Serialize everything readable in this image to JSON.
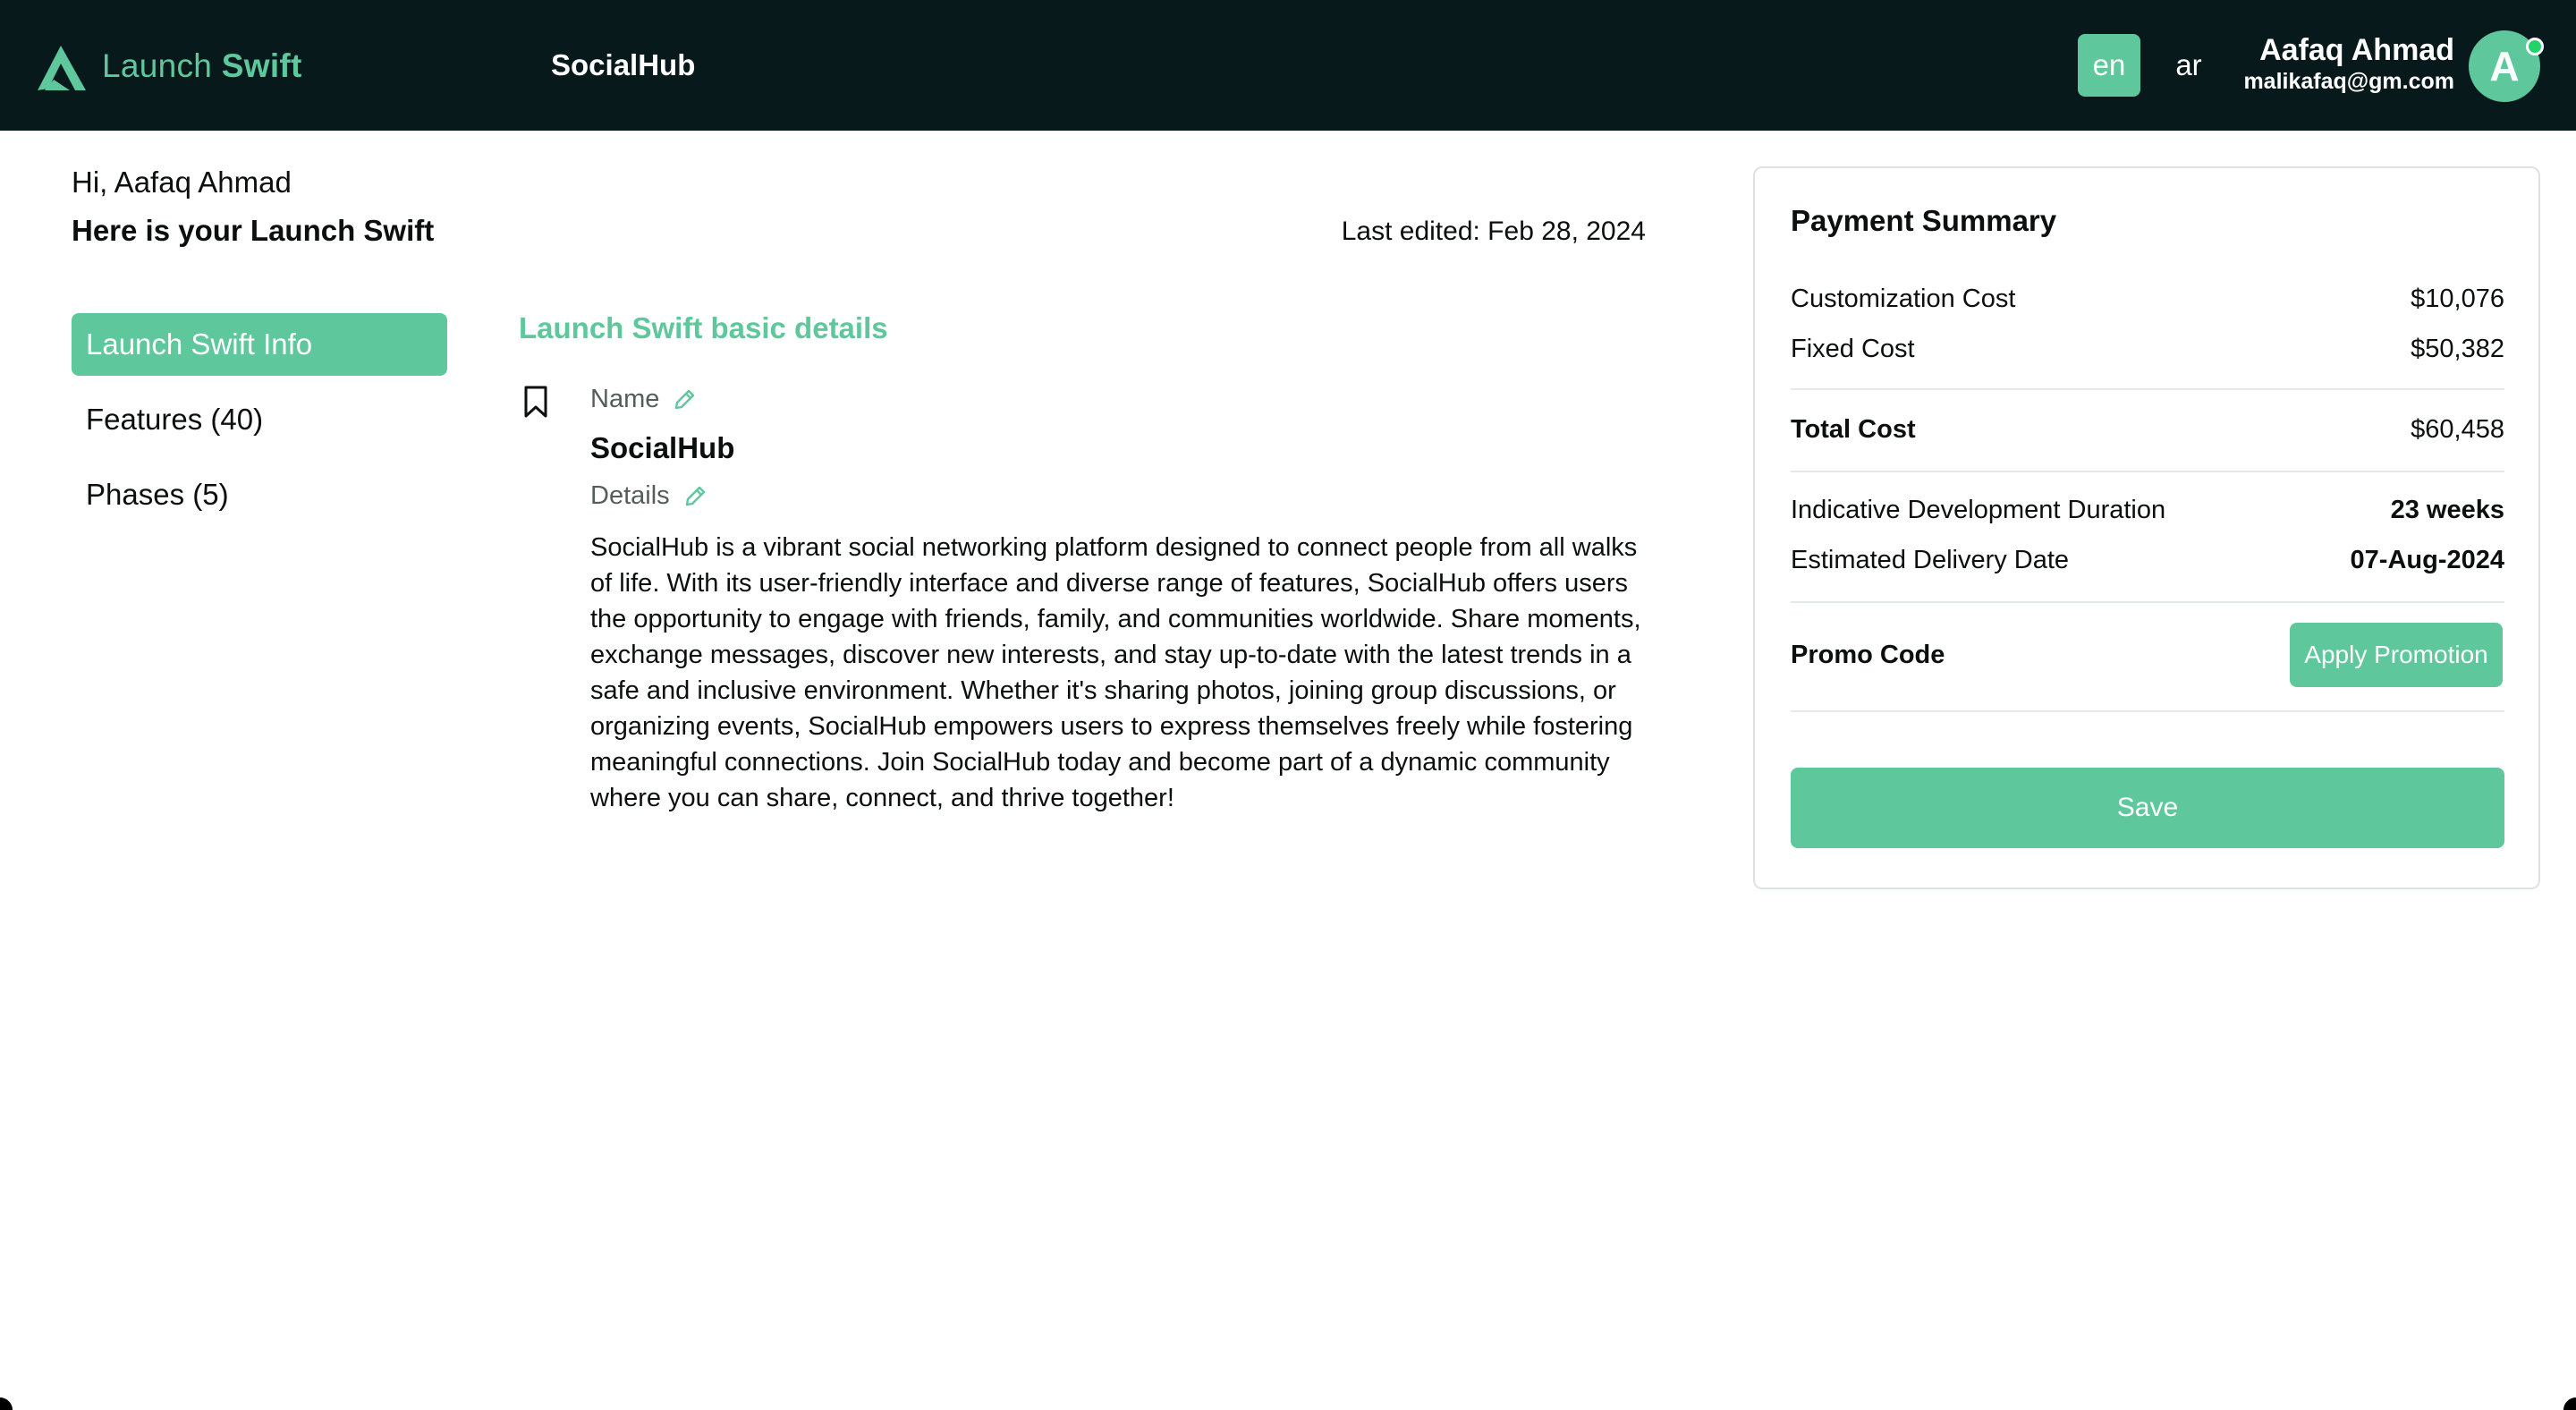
{
  "header": {
    "logo_text_light": "Launch",
    "logo_text_bold": "Swift",
    "app_name": "SocialHub",
    "languages": [
      "en",
      "ar"
    ],
    "active_language": "en",
    "user": {
      "name": "Aafaq Ahmad",
      "email": "malikafaq@gm.com",
      "avatar_initial": "A",
      "online": true
    }
  },
  "greeting": {
    "hello": "Hi, Aafaq Ahmad",
    "subtitle": "Here is your Launch Swift",
    "last_edited": "Last edited: Feb 28, 2024"
  },
  "sidenav": {
    "items": [
      {
        "label": "Launch Swift Info",
        "active": true
      },
      {
        "label": "Features (40)",
        "active": false
      },
      {
        "label": "Phases (5)",
        "active": false
      }
    ]
  },
  "main": {
    "section_title": "Launch Swift basic details",
    "name_label": "Name",
    "name_value": "SocialHub",
    "details_label": "Details",
    "details_text": "SocialHub is a vibrant social networking platform designed to connect people from all walks of life. With its user-friendly interface and diverse range of features, SocialHub offers users the opportunity to engage with friends, family, and communities worldwide. Share moments, exchange messages, discover new interests, and stay up-to-date with the latest trends in a safe and inclusive environment. Whether it's sharing photos, joining group discussions, or organizing events, SocialHub empowers users to express themselves freely while fostering meaningful connections. Join SocialHub today and become part of a dynamic community where you can share, connect, and thrive together!"
  },
  "payment": {
    "title": "Payment Summary",
    "customization_label": "Customization Cost",
    "customization_value": "$10,076",
    "fixed_label": "Fixed Cost",
    "fixed_value": "$50,382",
    "total_label": "Total Cost",
    "total_value": "$60,458",
    "duration_label": "Indicative Development Duration",
    "duration_value": "23 weeks",
    "delivery_label": "Estimated Delivery Date",
    "delivery_value": "07-Aug-2024",
    "promo_label": "Promo Code",
    "promo_button": "Apply Promotion",
    "save_button": "Save"
  },
  "colors": {
    "header_bg": "#08191c",
    "accent": "#5ec79c",
    "online": "#22d36a"
  },
  "icons": {
    "logo": "launch-swift-logo-icon",
    "bookmark": "bookmark-icon",
    "edit": "pencil-icon"
  }
}
